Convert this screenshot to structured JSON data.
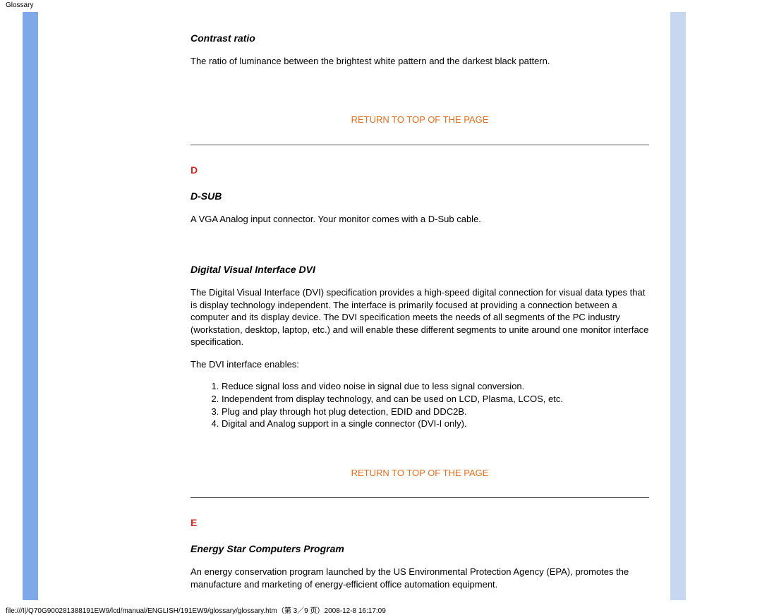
{
  "header": {
    "title": "Glossary"
  },
  "sections": {
    "contrast": {
      "term": "Contrast ratio",
      "body": "The ratio of luminance between the brightest white pattern and the darkest black pattern."
    },
    "returnLabel": "RETURN TO TOP OF THE PAGE",
    "d": {
      "letter": "D",
      "dsub": {
        "term": "D-SUB",
        "body": "A VGA Analog input connector. Your monitor comes with a D-Sub cable."
      },
      "dvi": {
        "term": "Digital Visual Interface DVI",
        "body1": "The Digital Visual Interface (DVI) specification provides a high-speed digital connection for visual data types that is display technology independent. The interface is primarily focused at providing a connection between a computer and its display device. The DVI specification meets the needs of all segments of the PC industry (workstation, desktop, laptop, etc.) and will enable these different segments to unite around one monitor interface specification.",
        "body2": "The DVI interface enables:",
        "list": [
          "Reduce signal loss and video noise in signal due to less signal conversion.",
          "Independent from display technology, and can be used on LCD, Plasma, LCOS, etc.",
          "Plug and play through hot plug detection, EDID and DDC2B.",
          "Digital and Analog support in a single connector (DVI-I only)."
        ]
      }
    },
    "e": {
      "letter": "E",
      "energy": {
        "term": "Energy Star Computers Program",
        "body": "An energy conservation program launched by the US Environmental Protection Agency (EPA), promotes the manufacture and marketing of energy-efficient office automation equipment."
      }
    }
  },
  "footer": {
    "text": "file:///I|/Q70G900281388191EW9/lcd/manual/ENGLISH/191EW9/glossary/glossary.htm（第 3／9 页）2008-12-8 16:17:09"
  }
}
